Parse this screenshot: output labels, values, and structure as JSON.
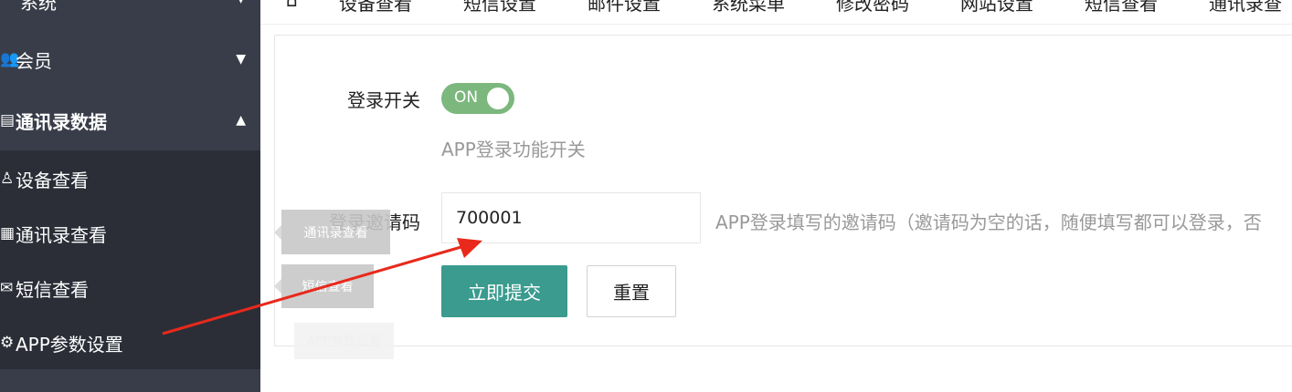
{
  "sidebar": {
    "top_partial_label": "系统",
    "items": [
      {
        "label": "会员",
        "icon": "users-icon"
      },
      {
        "label": "通讯录数据",
        "icon": "list-icon"
      }
    ],
    "subitems": [
      {
        "label": "设备查看",
        "icon": "user-icon"
      },
      {
        "label": "通讯录查看",
        "icon": "phonebook-icon"
      },
      {
        "label": "短信查看",
        "icon": "envelope-icon"
      },
      {
        "label": "APP参数设置",
        "icon": "gear-icon"
      }
    ]
  },
  "topbar": {
    "tabs": [
      "设备查看",
      "短信设置",
      "邮件设置",
      "系统菜单",
      "修改密码",
      "网站设置",
      "短信查看",
      "通讯录查"
    ]
  },
  "form": {
    "login_switch_label": "登录开关",
    "switch_text": "ON",
    "switch_state": true,
    "switch_hint": "APP登录功能开关",
    "invite_label": "登录邀请码",
    "invite_value": "700001",
    "invite_hint": "APP登录填写的邀请码（邀请码为空的话，随便填写都可以登录，否",
    "submit_label": "立即提交",
    "reset_label": "重置"
  },
  "tooltips": [
    "通讯录查看",
    "短信查看",
    "APP参数设置"
  ],
  "colors": {
    "sidebar_bg": "#393D49",
    "submenu_bg": "#2B2E37",
    "primary": "#3A9B8E",
    "switch_on": "#7CB77E",
    "annotation_arrow": "#E8291C"
  }
}
